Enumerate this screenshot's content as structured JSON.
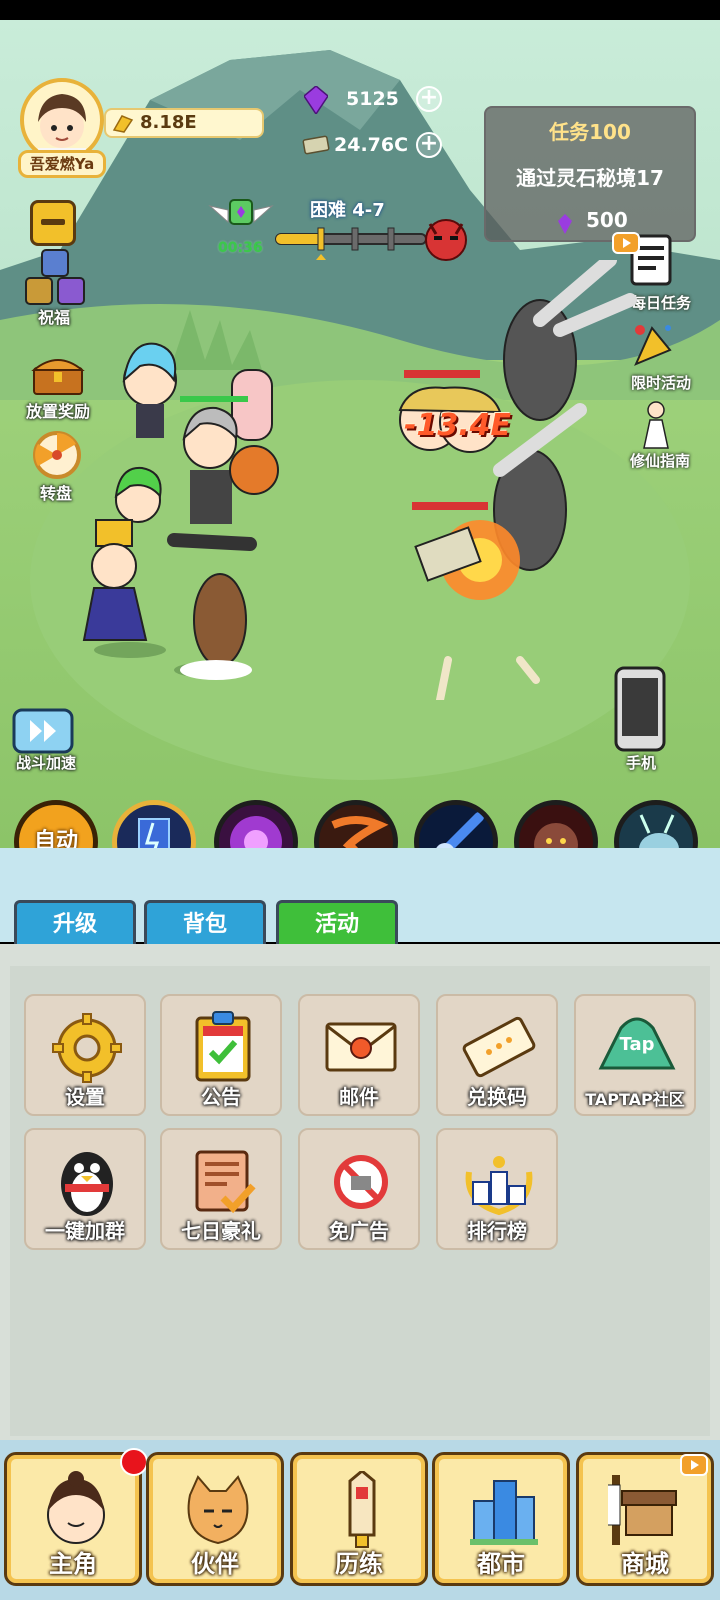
{
  "player": {
    "name": "吾爱燃Ya",
    "gold": "8.18E"
  },
  "resources": {
    "gems": "5125",
    "cash": "24.76C"
  },
  "stage": {
    "label": "困难 4-7",
    "timer": "00:36"
  },
  "task": {
    "title": "任务100",
    "description": "通过灵石秘境17",
    "reward": "500"
  },
  "left_menu": {
    "blessing": "祝福",
    "idle_reward": "放置奖励",
    "wheel": "转盘",
    "battle_speed": "战斗加速"
  },
  "right_menu": {
    "daily_tasks": "每日任务",
    "limited_event": "限时活动",
    "guide": "修仙指南",
    "phone": "手机"
  },
  "battle": {
    "damage": "-13.4E"
  },
  "skills": {
    "auto_label": "自动"
  },
  "tabs": {
    "upgrade": "升级",
    "bag": "背包",
    "activity": "活动"
  },
  "activity_items": {
    "settings": "设置",
    "notice": "公告",
    "mail": "邮件",
    "redeem": "兑换码",
    "taptap": "TAPTAP社区",
    "qq_group": "一键加群",
    "seven_day": "七日豪礼",
    "no_ads": "免广告",
    "ranking": "排行榜"
  },
  "icon_text": {
    "tap": "Tap"
  },
  "bottom_nav": {
    "hero": "主角",
    "partner": "伙伴",
    "training": "历练",
    "city": "都市",
    "shop": "商城"
  },
  "colors": {
    "accent_gold": "#e8b23a",
    "active_tab": "#3fbf3a",
    "inactive_tab": "#2fa3d8",
    "gem": "#9a3ce0"
  }
}
